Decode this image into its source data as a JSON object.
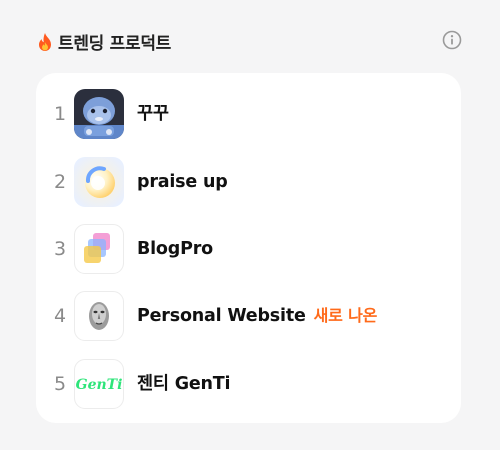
{
  "header": {
    "fire_icon": "fire-icon",
    "title": "트렌딩 프로덕트",
    "info_icon": "info-icon"
  },
  "products": [
    {
      "rank": "1",
      "name": "꾸꾸",
      "badge": "",
      "thumbnail_icon": "blue-character-icon"
    },
    {
      "rank": "2",
      "name": "praise up",
      "badge": "",
      "thumbnail_icon": "sphere-gradient-icon"
    },
    {
      "rank": "3",
      "name": "BlogPro",
      "badge": "",
      "thumbnail_icon": "layered-squares-icon"
    },
    {
      "rank": "4",
      "name": "Personal Website",
      "badge": "새로 나온",
      "thumbnail_icon": "face-mask-icon"
    },
    {
      "rank": "5",
      "name": "젠티 GenTi",
      "badge": "",
      "thumbnail_icon": "genti-logo",
      "thumbnail_text": "GenTi"
    }
  ],
  "colors": {
    "background": "#f5f5f6",
    "card": "#ffffff",
    "badge": "#ff6a1a",
    "rank": "#8a8a8a",
    "genti_green": "#2ee57a"
  }
}
